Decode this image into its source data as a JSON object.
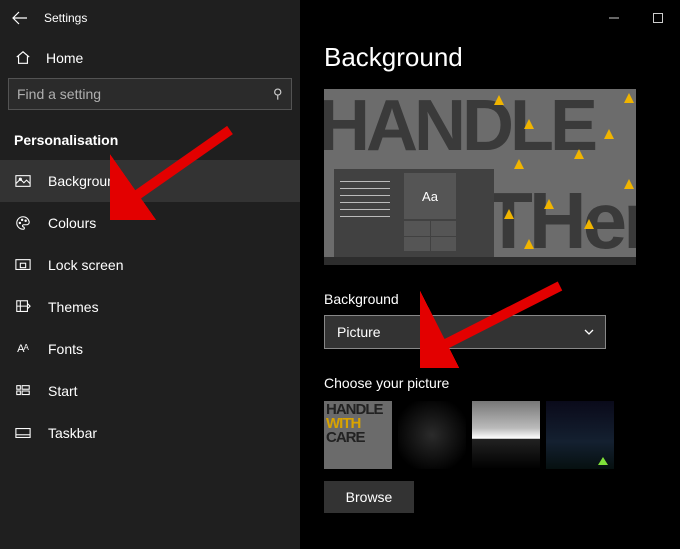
{
  "window": {
    "title": "Settings"
  },
  "sidebar": {
    "home": "Home",
    "search_placeholder": "Find a setting",
    "section": "Personalisation",
    "items": [
      {
        "label": "Background"
      },
      {
        "label": "Colours"
      },
      {
        "label": "Lock screen"
      },
      {
        "label": "Themes"
      },
      {
        "label": "Fonts"
      },
      {
        "label": "Start"
      },
      {
        "label": "Taskbar"
      }
    ]
  },
  "page": {
    "heading": "Background",
    "preview_sample_text": "Aa",
    "preview_word_top": "HANDLE",
    "preview_word_bottom": "THere",
    "dropdown_label": "Background",
    "dropdown_value": "Picture",
    "choose_label": "Choose your picture",
    "thumb1_text": "HANDLE\nWITH\nCARE",
    "browse": "Browse"
  }
}
